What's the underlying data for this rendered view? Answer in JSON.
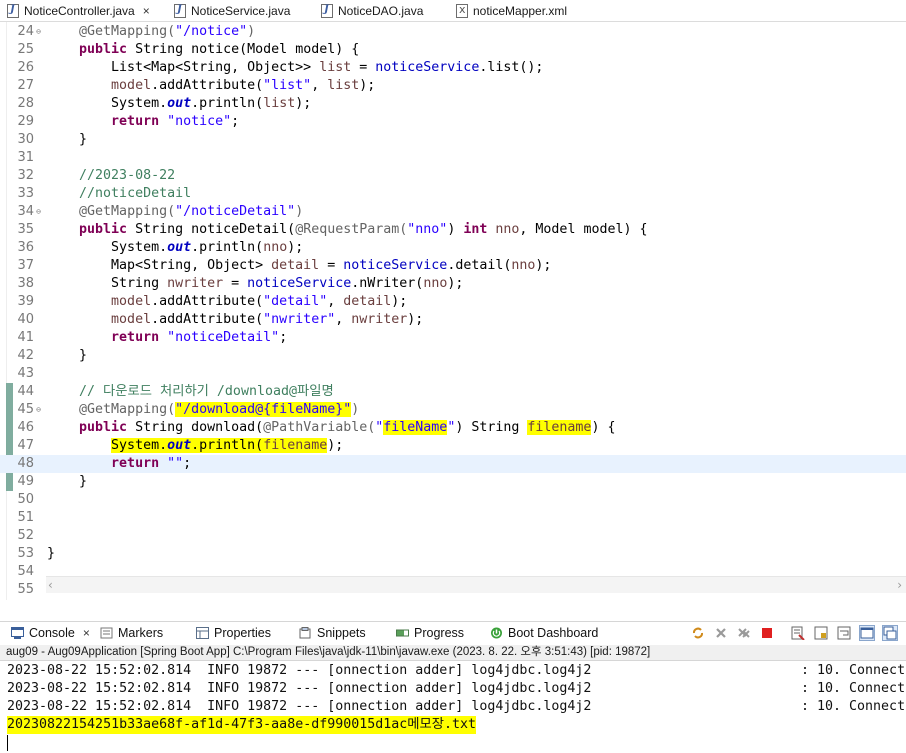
{
  "tabs": [
    {
      "label": "NoticeController.java",
      "type": "java",
      "active": true,
      "closable": true
    },
    {
      "label": "NoticeService.java",
      "type": "java",
      "active": false,
      "closable": false
    },
    {
      "label": "NoticeDAO.java",
      "type": "java",
      "active": false,
      "closable": false
    },
    {
      "label": "noticeMapper.xml",
      "type": "xml",
      "active": false,
      "closable": false
    }
  ],
  "tab_close_icon": "×",
  "editor": {
    "lines": [
      {
        "num": "24",
        "fold": true,
        "segments": [
          {
            "t": "    "
          },
          {
            "t": "@GetMapping(",
            "c": "ann"
          },
          {
            "t": "\"/notice\"",
            "c": "str"
          },
          {
            "t": ")",
            "c": "ann"
          }
        ]
      },
      {
        "num": "25",
        "segments": [
          {
            "t": "    "
          },
          {
            "t": "public",
            "c": "kw"
          },
          {
            "t": " String notice(Model model) {"
          }
        ]
      },
      {
        "num": "26",
        "segments": [
          {
            "t": "        List<Map<String, Object>> "
          },
          {
            "t": "list",
            "c": "var"
          },
          {
            "t": " = "
          },
          {
            "t": "noticeService",
            "c": "f2"
          },
          {
            "t": ".list();"
          }
        ]
      },
      {
        "num": "27",
        "segments": [
          {
            "t": "        "
          },
          {
            "t": "model",
            "c": "var"
          },
          {
            "t": ".addAttribute("
          },
          {
            "t": "\"list\"",
            "c": "str"
          },
          {
            "t": ", "
          },
          {
            "t": "list",
            "c": "var"
          },
          {
            "t": ");"
          }
        ]
      },
      {
        "num": "28",
        "segments": [
          {
            "t": "        System."
          },
          {
            "t": "out",
            "c": "fld"
          },
          {
            "t": ".println("
          },
          {
            "t": "list",
            "c": "var"
          },
          {
            "t": ");"
          }
        ]
      },
      {
        "num": "29",
        "segments": [
          {
            "t": "        "
          },
          {
            "t": "return",
            "c": "kw"
          },
          {
            "t": " "
          },
          {
            "t": "\"notice\"",
            "c": "str"
          },
          {
            "t": ";"
          }
        ]
      },
      {
        "num": "30",
        "segments": [
          {
            "t": "    }"
          }
        ]
      },
      {
        "num": "31",
        "segments": []
      },
      {
        "num": "32",
        "segments": [
          {
            "t": "    "
          },
          {
            "t": "//2023-08-22",
            "c": "cmt"
          }
        ]
      },
      {
        "num": "33",
        "segments": [
          {
            "t": "    "
          },
          {
            "t": "//noticeDetail",
            "c": "cmt"
          }
        ]
      },
      {
        "num": "34",
        "fold": true,
        "segments": [
          {
            "t": "    "
          },
          {
            "t": "@GetMapping(",
            "c": "ann"
          },
          {
            "t": "\"/noticeDetail\"",
            "c": "str"
          },
          {
            "t": ")",
            "c": "ann"
          }
        ]
      },
      {
        "num": "35",
        "segments": [
          {
            "t": "    "
          },
          {
            "t": "public",
            "c": "kw"
          },
          {
            "t": " String noticeDetail("
          },
          {
            "t": "@RequestParam(",
            "c": "ann"
          },
          {
            "t": "\"nno\"",
            "c": "str"
          },
          {
            "t": ") "
          },
          {
            "t": "int",
            "c": "kw"
          },
          {
            "t": " "
          },
          {
            "t": "nno",
            "c": "var"
          },
          {
            "t": ", Model model) {"
          }
        ]
      },
      {
        "num": "36",
        "segments": [
          {
            "t": "        System."
          },
          {
            "t": "out",
            "c": "fld"
          },
          {
            "t": ".println("
          },
          {
            "t": "nno",
            "c": "var"
          },
          {
            "t": ");"
          }
        ]
      },
      {
        "num": "37",
        "segments": [
          {
            "t": "        Map<String, Object> "
          },
          {
            "t": "detail",
            "c": "var"
          },
          {
            "t": " = "
          },
          {
            "t": "noticeService",
            "c": "f2"
          },
          {
            "t": ".detail("
          },
          {
            "t": "nno",
            "c": "var"
          },
          {
            "t": ");"
          }
        ]
      },
      {
        "num": "38",
        "segments": [
          {
            "t": "        String "
          },
          {
            "t": "nwriter",
            "c": "var"
          },
          {
            "t": " = "
          },
          {
            "t": "noticeService",
            "c": "f2"
          },
          {
            "t": ".nWriter("
          },
          {
            "t": "nno",
            "c": "var"
          },
          {
            "t": ");"
          }
        ]
      },
      {
        "num": "39",
        "segments": [
          {
            "t": "        "
          },
          {
            "t": "model",
            "c": "var"
          },
          {
            "t": ".addAttribute("
          },
          {
            "t": "\"detail\"",
            "c": "str"
          },
          {
            "t": ", "
          },
          {
            "t": "detail",
            "c": "var"
          },
          {
            "t": ");"
          }
        ]
      },
      {
        "num": "40",
        "segments": [
          {
            "t": "        "
          },
          {
            "t": "model",
            "c": "var"
          },
          {
            "t": ".addAttribute("
          },
          {
            "t": "\"nwriter\"",
            "c": "str"
          },
          {
            "t": ", "
          },
          {
            "t": "nwriter",
            "c": "var"
          },
          {
            "t": ");"
          }
        ]
      },
      {
        "num": "41",
        "segments": [
          {
            "t": "        "
          },
          {
            "t": "return",
            "c": "kw"
          },
          {
            "t": " "
          },
          {
            "t": "\"noticeDetail\"",
            "c": "str"
          },
          {
            "t": ";"
          }
        ]
      },
      {
        "num": "42",
        "segments": [
          {
            "t": "    }"
          }
        ]
      },
      {
        "num": "43",
        "segments": []
      },
      {
        "num": "44",
        "mark": true,
        "segments": [
          {
            "t": "    "
          },
          {
            "t": "// 다운로드 처리하기 /download@파일명",
            "c": "cmt"
          }
        ]
      },
      {
        "num": "45",
        "mark": true,
        "fold": true,
        "segments": [
          {
            "t": "    "
          },
          {
            "t": "@GetMapping(",
            "c": "ann"
          },
          {
            "t": "\"/download@{fileName}\"",
            "c": "str hl"
          },
          {
            "t": ")",
            "c": "ann"
          }
        ]
      },
      {
        "num": "46",
        "mark": true,
        "segments": [
          {
            "t": "    "
          },
          {
            "t": "public",
            "c": "kw"
          },
          {
            "t": " String download("
          },
          {
            "t": "@PathVariable(",
            "c": "ann"
          },
          {
            "t": "\"",
            "c": "str"
          },
          {
            "t": "fileName",
            "c": "str hl"
          },
          {
            "t": "\"",
            "c": "str"
          },
          {
            "t": ") String "
          },
          {
            "t": "filename",
            "c": "var hl"
          },
          {
            "t": ") {"
          }
        ]
      },
      {
        "num": "47",
        "mark": true,
        "segments": [
          {
            "t": "        "
          },
          {
            "t": "System.",
            "c": "hl"
          },
          {
            "t": "out",
            "c": "fld hl"
          },
          {
            "t": ".println(",
            "c": "hl"
          },
          {
            "t": "filename",
            "c": "var hl"
          },
          {
            "t": ");"
          }
        ]
      },
      {
        "num": "48",
        "mark": true,
        "current": true,
        "segments": [
          {
            "t": "        "
          },
          {
            "t": "return",
            "c": "kw"
          },
          {
            "t": " "
          },
          {
            "t": "\"\"",
            "c": "str"
          },
          {
            "t": ";"
          }
        ]
      },
      {
        "num": "49",
        "mark": true,
        "segments": [
          {
            "t": "    }"
          }
        ]
      },
      {
        "num": "50",
        "segments": []
      },
      {
        "num": "51",
        "segments": []
      },
      {
        "num": "52",
        "segments": []
      },
      {
        "num": "53",
        "segments": [
          {
            "t": "}"
          }
        ]
      },
      {
        "num": "54",
        "segments": []
      },
      {
        "num": "55",
        "segments": []
      }
    ]
  },
  "scroll_arrows": {
    "left": "‹",
    "right": "›"
  },
  "panel": {
    "tabs": [
      {
        "label": "Console",
        "icon": "console-icon",
        "active": true
      },
      {
        "label": "Markers",
        "icon": "markers-icon"
      },
      {
        "label": "Properties",
        "icon": "properties-icon"
      },
      {
        "label": "Snippets",
        "icon": "snippets-icon"
      },
      {
        "label": "Progress",
        "icon": "progress-icon"
      },
      {
        "label": "Boot Dashboard",
        "icon": "boot-dashboard-icon"
      }
    ],
    "close_icon": "×",
    "toolbar_icons": [
      "sync-icon",
      "remove-launch-icon",
      "remove-all-icon",
      "terminate-icon",
      "clear-console-icon",
      "scroll-lock-icon",
      "word-wrap-icon",
      "pin-console-icon",
      "display-console-icon"
    ],
    "launch_text": "aug09 - Aug09Application [Spring Boot App] C:\\Program Files\\java\\jdk-11\\bin\\javaw.exe  (2023. 8. 22. 오후 3:51:43) [pid: 19872]"
  },
  "console": {
    "lines": [
      {
        "left": "2023-08-22 15:52:02.814  INFO 19872 --- [onnection adder] log4jdbc.log4j2",
        "right": ": 10. Connect"
      },
      {
        "left": "2023-08-22 15:52:02.814  INFO 19872 --- [onnection adder] log4jdbc.log4j2",
        "right": ": 10. Connect"
      },
      {
        "left": "2023-08-22 15:52:02.814  INFO 19872 --- [onnection adder] log4jdbc.log4j2",
        "right": ": 10. Connect"
      }
    ],
    "output_line": "20230822154251b33ae68f-af1d-47f3-aa8e-df990015d1ac메모장.txt"
  },
  "colors": {
    "keyword": "#7f0055",
    "string": "#2a00ff",
    "comment": "#3f7f5f",
    "highlight": "#ffff00",
    "current_line": "#e8f2fe"
  }
}
